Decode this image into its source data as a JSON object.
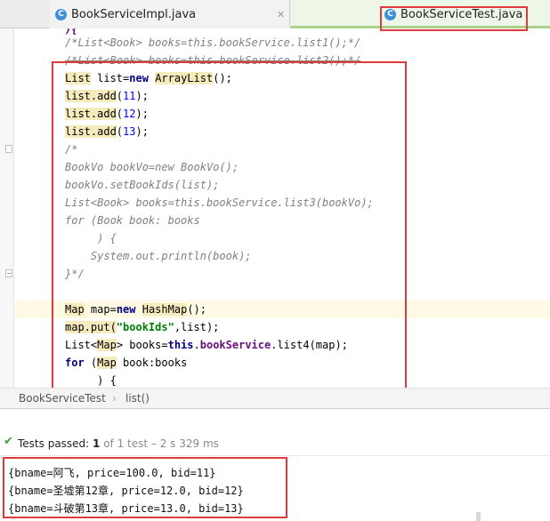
{
  "tabs": [
    {
      "label": "BookServiceImpl.java",
      "icon": "class-icon",
      "close": "✕"
    },
    {
      "label": "BookServiceTest.java",
      "icon": "class-icon",
      "active": true
    }
  ],
  "code": {
    "partial_top": "/*List<Book> books=this.bookService.list1();*/",
    "line_strike": "/*List<Book> books=this.bookService.list2();*/",
    "line_list": "List list=new ArrayList();",
    "add11": "list.add(11);",
    "add12": "list.add(12);",
    "add13": "list.add(13);",
    "c_open": "/*",
    "c1": "BookVo bookVo=new BookVo();",
    "c2": "bookVo.setBookIds(list);",
    "c3": "List<Book> books=this.bookService.list3(bookVo);",
    "c4": "for (Book book: books",
    "c5": "     ) {",
    "c6": "    System.out.println(book);",
    "c7": "}*/",
    "map1": "Map map=new HashMap();",
    "map2_a": "map.put(",
    "map2_s": "\"bookIds\"",
    "map2_b": ",list);",
    "map3_a": "List<",
    "map3_b": "Map",
    "map3_c": "> books=",
    "map3_this": "this",
    "map3_d": ".",
    "map3_f": "bookService",
    "map3_e": ".list4(map);",
    "for1_kw": "for",
    "for1_a": " (",
    "for1_b": "Map",
    "for1_c": " book:books",
    "for2": "     ) {"
  },
  "breadcrumb": {
    "class": "BookServiceTest",
    "sep": "›",
    "method": "list()"
  },
  "tests": {
    "icon": "check-icon",
    "prefix": "Tests passed: ",
    "count": "1",
    "suffix": " of 1 test – 2 s 329 ms"
  },
  "console": [
    "{bname=阿飞, price=100.0, bid=11}",
    "{bname=圣墟第12章, price=12.0, bid=12}",
    "{bname=斗破第13章, price=13.0, bid=13}"
  ],
  "colors": {
    "annotation_box": "#e0393e",
    "keyword": "#000080",
    "number": "#0000ff",
    "string": "#008000",
    "comment": "#808080",
    "pass": "#3d9c3d"
  }
}
